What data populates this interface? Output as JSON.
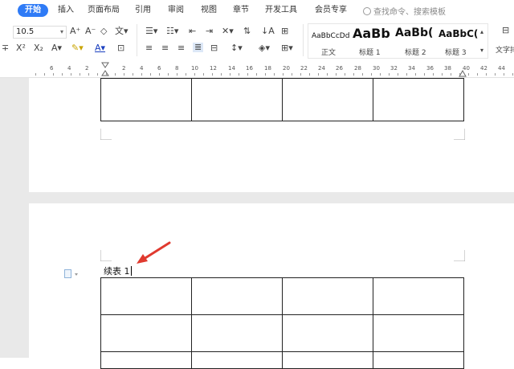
{
  "tabs": [
    "开始",
    "插入",
    "页面布局",
    "引用",
    "审阅",
    "视图",
    "章节",
    "开发工具",
    "会员专享"
  ],
  "search_placeholder": "查找命令、搜索模板",
  "font_size": "10.5",
  "styles": [
    {
      "sample": "AaBbCcDd",
      "name": "正文"
    },
    {
      "sample": "AaBb",
      "name": "标题 1"
    },
    {
      "sample": "AaBb(",
      "name": "标题 2"
    },
    {
      "sample": "AaBbC(",
      "name": "标题 3"
    }
  ],
  "text_tool_label": "文字排",
  "ruler_numbers": [
    "6",
    "4",
    "2",
    "2",
    "4",
    "6",
    "8",
    "10",
    "12",
    "14",
    "16",
    "18",
    "20",
    "22",
    "24",
    "26",
    "28",
    "30",
    "32",
    "34",
    "36",
    "38",
    "40",
    "42",
    "44"
  ],
  "caption": "续表 1",
  "colors": {
    "accent": "#2f7bf6",
    "annotation_arrow": "#e03a2f"
  }
}
